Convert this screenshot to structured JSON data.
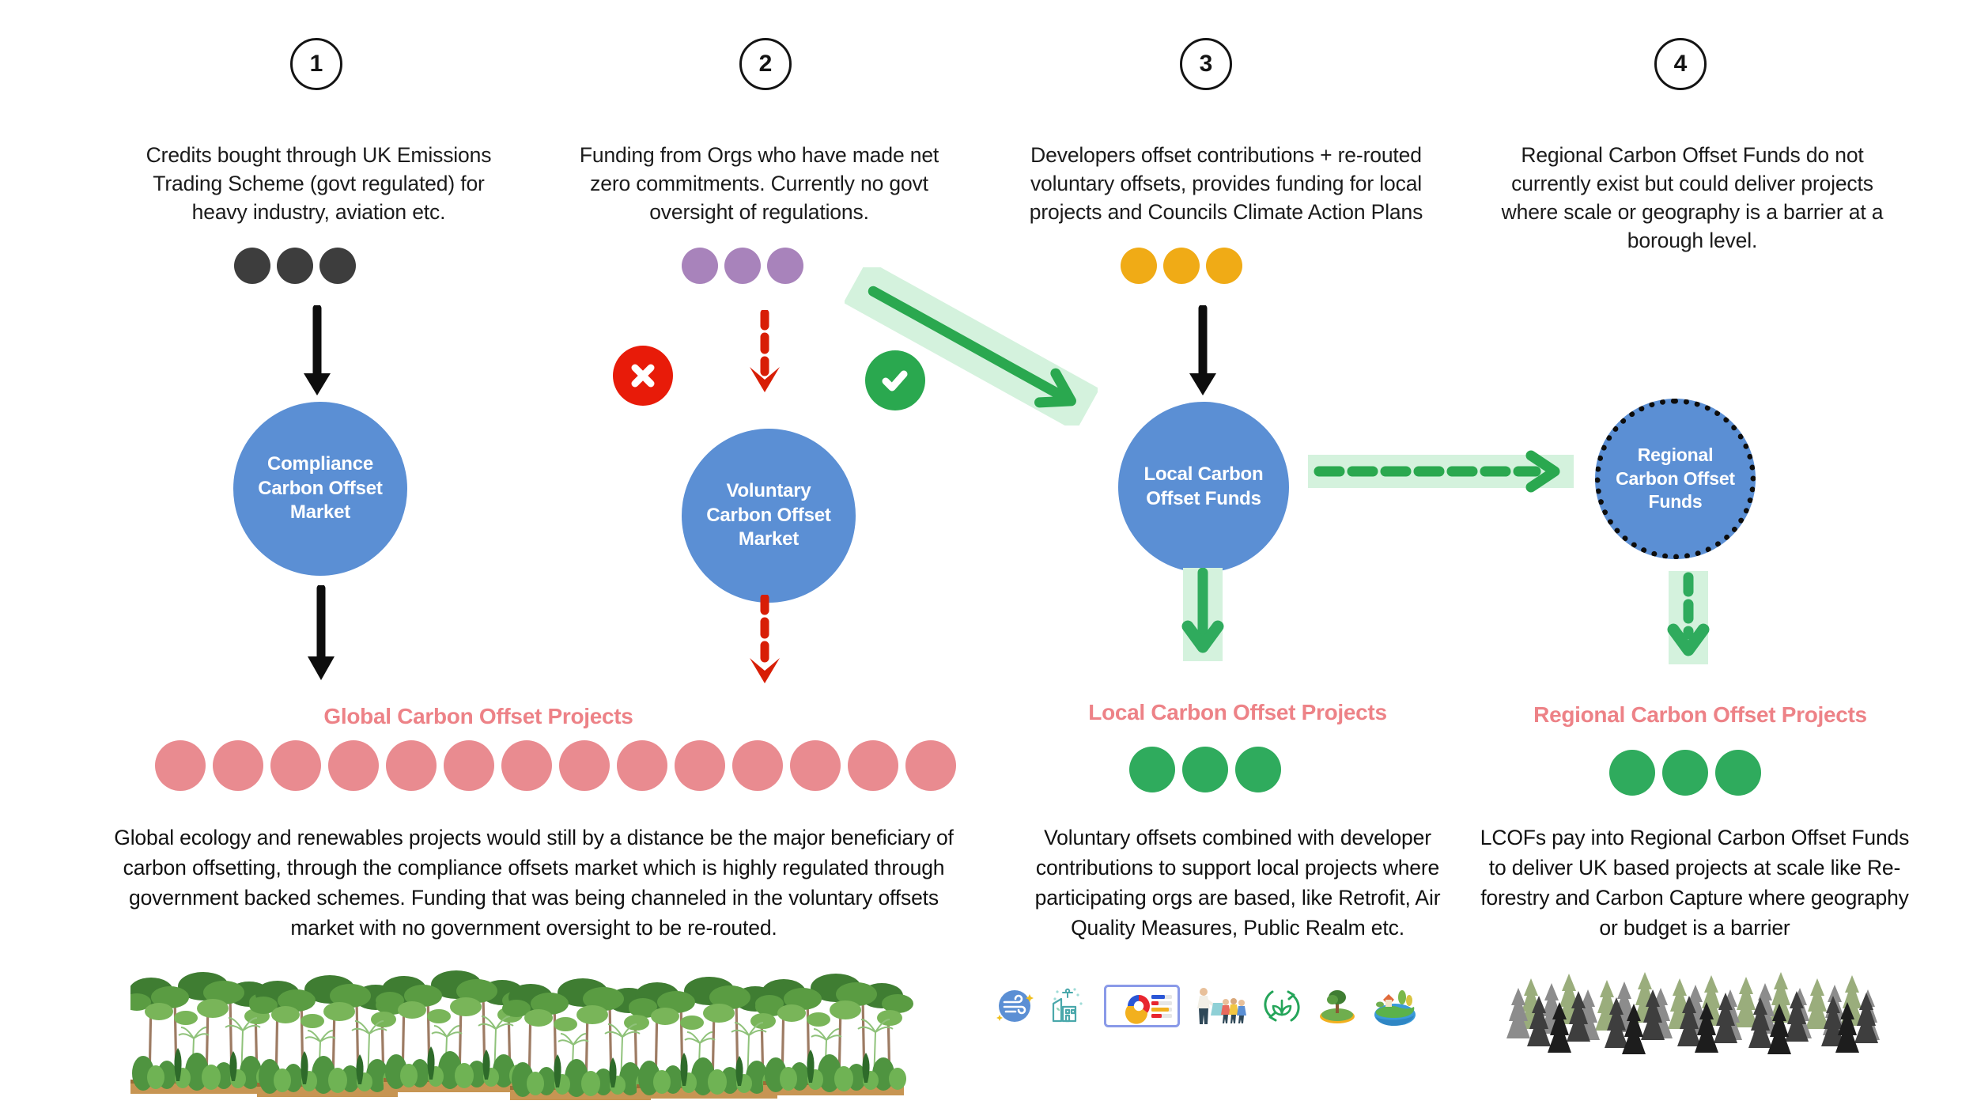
{
  "diagram": {
    "title_colors": {
      "blue_bubble": "#5b8fd4",
      "pink_heading": "#ed8287",
      "green_accent": "#2aa84f",
      "green_pale": "#d4f2dd",
      "red_accent": "#d81e06",
      "orange_dot": "#f0ab16",
      "purple_dot": "#a883bb",
      "dark_dot": "#3d3d3d",
      "pink_dot": "#e98b90",
      "green_dot": "#2fab5d"
    },
    "columns": [
      {
        "number": "1",
        "caption": "Credits bought through UK Emissions Trading Scheme (govt regulated) for heavy industry, aviation etc.",
        "dot_count": 3,
        "dot_color": "#3d3d3d",
        "bubble_label": "Compliance Carbon Offset Market",
        "bubble_dotted": false,
        "project_title": "Global Carbon Offset Projects",
        "project_dot_count": 14,
        "project_dot_color": "#e98b90",
        "body": "Global ecology and renewables projects would still by a distance be the major beneficiary of carbon offsetting, through the compliance offsets market which is highly regulated through government backed schemes. Funding that was being channeled in the voluntary offsets market with no government oversight to be re-routed.",
        "illustration": "rainforest-illustration"
      },
      {
        "number": "2",
        "caption": "Funding from Orgs who have made net zero commitments. Currently no govt oversight of regulations.",
        "dot_count": 3,
        "dot_color": "#a883bb",
        "bubble_label": "Voluntary Carbon Offset Market",
        "bubble_dotted": false,
        "project_title": "",
        "project_dot_count": 0,
        "project_dot_color": "",
        "body": "",
        "illustration": ""
      },
      {
        "number": "3",
        "caption": "Developers offset contributions + re-routed voluntary offsets, provides funding for local projects and Councils Climate Action Plans",
        "dot_count": 3,
        "dot_color": "#f0ab16",
        "bubble_label": "Local Carbon Offset Funds",
        "bubble_dotted": false,
        "project_title": "Local Carbon Offset Projects",
        "project_dot_count": 3,
        "project_dot_color": "#2fab5d",
        "body": "Voluntary offsets combined with developer contributions to support local projects where participating orgs are based, like Retrofit, Air Quality Measures, Public Realm etc.",
        "illustration": "local-project-icon-strip"
      },
      {
        "number": "4",
        "caption": "Regional Carbon Offset Funds do not currently exist but could deliver projects where scale or geography is a barrier at a borough level.",
        "dot_count": 0,
        "dot_color": "",
        "bubble_label": "Regional Carbon Offset Funds",
        "bubble_dotted": true,
        "project_title": "Regional Carbon Offset Projects",
        "project_dot_count": 3,
        "project_dot_color": "#2fab5d",
        "body": "LCOFs pay into Regional Carbon Offset Funds to deliver UK based projects at scale like Re-forestry and Carbon Capture where geography or budget is a barrier",
        "illustration": "pine-forest-illustration"
      }
    ],
    "bubble_labels_lines": {
      "compliance": [
        "Compliance",
        "Carbon Offset",
        "Market"
      ],
      "voluntary": [
        "Voluntary",
        "Carbon Offset",
        "Market"
      ],
      "local": [
        "Local Carbon",
        "Offset Funds"
      ],
      "regional": [
        "Regional",
        "Carbon Offset",
        "Funds"
      ]
    },
    "markers": {
      "cross_label": "blocked-route-cross",
      "tick_label": "approved-route-tick"
    },
    "connectors": [
      {
        "name": "col1-down-arrow",
        "style": "solid",
        "color": "#0d0d0d"
      },
      {
        "name": "col2-down-arrow",
        "style": "dashed",
        "color": "#d81e06"
      },
      {
        "name": "col2-to-col3-diagonal-arrow",
        "style": "solid",
        "color": "#2aa84f"
      },
      {
        "name": "col3-down-arrow",
        "style": "solid",
        "color": "#0d0d0d"
      },
      {
        "name": "col1-bubble-down-arrow",
        "style": "solid",
        "color": "#0d0d0d"
      },
      {
        "name": "col2-bubble-down-arrow",
        "style": "dashed",
        "color": "#d81e06"
      },
      {
        "name": "local-to-regional-arrow",
        "style": "dashed",
        "color": "#2aa84f"
      },
      {
        "name": "local-funds-down-arrow",
        "style": "solid",
        "color": "#2aa84f"
      },
      {
        "name": "regional-funds-down-arrow",
        "style": "dashed",
        "color": "#2aa84f"
      }
    ],
    "project_icons": [
      "clean-air-icon",
      "eco-building-icon",
      "dashboard-report-icon",
      "community-volunteers-icon",
      "recycling-leaf-icon",
      "tree-park-icon",
      "eco-earth-icon"
    ]
  }
}
